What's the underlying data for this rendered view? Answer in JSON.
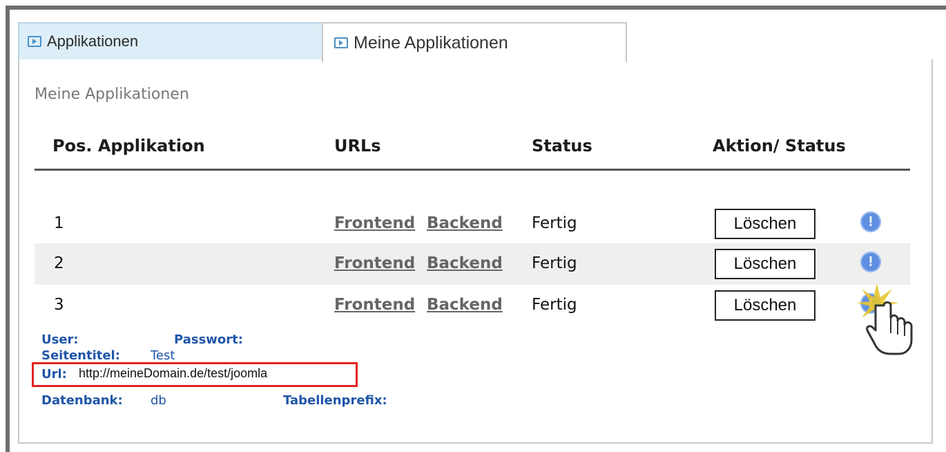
{
  "tabs": [
    {
      "label": "Applikationen",
      "active": false
    },
    {
      "label": "Meine Applikationen",
      "active": true
    }
  ],
  "section_title": "Meine Applikationen",
  "table": {
    "headers": [
      "Pos. Applikation",
      "URLs",
      "Status",
      "Aktion/ Status"
    ],
    "rows": [
      {
        "pos": "1",
        "frontend": "Frontend",
        "backend": "Backend",
        "status": "Fertig",
        "action": "Löschen",
        "shaded": false
      },
      {
        "pos": "2",
        "frontend": "Frontend",
        "backend": "Backend",
        "status": "Fertig",
        "action": "Löschen",
        "shaded": true
      },
      {
        "pos": "3",
        "frontend": "Frontend",
        "backend": "Backend",
        "status": "Fertig",
        "action": "Löschen",
        "shaded": false
      }
    ]
  },
  "details": {
    "user_label": "User:",
    "password_label": "Passwort:",
    "title_label": "Seitentitel:",
    "title_value": "Test",
    "url_label": "Url:",
    "url_value": "http://meineDomain.de/test/joomla",
    "db_label": "Datenbank:",
    "db_value": "db",
    "prefix_label": "Tabellenprefix:"
  },
  "icons": {
    "tab_icon": "expand-arrow-icon",
    "info_icon": "info-icon",
    "cursor": "hand-pointer-cursor"
  },
  "colors": {
    "link_blue": "#1f56a8",
    "highlight_red": "#e32222",
    "info_blue": "#5f8fe0"
  }
}
